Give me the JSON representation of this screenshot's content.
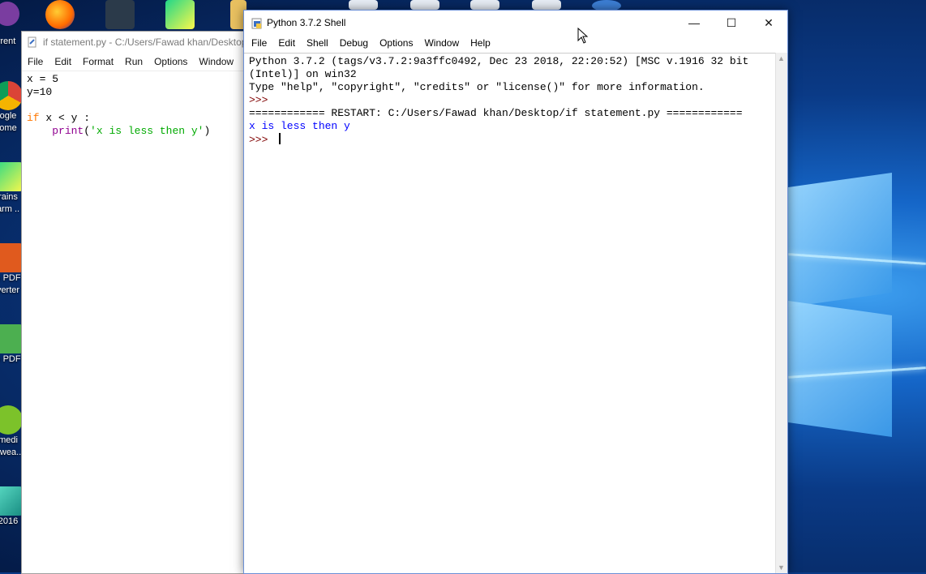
{
  "desktop": {
    "icons": [
      {
        "label": "rrent",
        "icon": "torrent-icon",
        "color": "#7b3fa0"
      },
      {
        "label": "ogle ome",
        "icon": "chrome-icon",
        "color": "#dd4b39"
      },
      {
        "label": "rains arm ..",
        "icon": "pycharm-icon",
        "color": "#21d789"
      },
      {
        "label": "o PDF verter",
        "icon": "pdf-converter-icon",
        "color": "#e05a1e"
      },
      {
        "label": "o PDF",
        "icon": "pdf-icon",
        "color": "#4caf50"
      },
      {
        "label": "medi awea..",
        "icon": "media-icon",
        "color": "#7cc22a"
      },
      {
        "label": "2016",
        "icon": "maya-icon",
        "color": "#22a8a0"
      }
    ],
    "top_icons": [
      "eclipse-icon",
      "firefox-icon",
      "filmora-icon",
      "pycharm-edu-icon",
      "folder-icon",
      "doc-icon",
      "doc2-icon",
      "doc3-icon",
      "doc4-icon",
      "globe-icon"
    ]
  },
  "editor": {
    "title": "if statement.py - C:/Users/Fawad khan/Desktop",
    "menu": [
      "File",
      "Edit",
      "Format",
      "Run",
      "Options",
      "Window"
    ],
    "lines": [
      {
        "plain": "x = 5"
      },
      {
        "plain": "y=10"
      },
      {
        "plain": ""
      },
      {
        "kw": "if",
        "rest": " x < y :"
      },
      {
        "indent": "    ",
        "bi": "print",
        "open": "(",
        "str": "'x is less then y'",
        "close": ")"
      }
    ]
  },
  "shell": {
    "title": "Python 3.7.2 Shell",
    "menu": [
      "File",
      "Edit",
      "Shell",
      "Debug",
      "Options",
      "Window",
      "Help"
    ],
    "controls": {
      "minimize": "—",
      "maximize": "☐",
      "close": "✕"
    },
    "banner1": "Python 3.7.2 (tags/v3.7.2:9a3ffc0492, Dec 23 2018, 22:20:52) [MSC v.1916 32 bit",
    "banner2": "(Intel)] on win32",
    "banner3": "Type \"help\", \"copyright\", \"credits\" or \"license()\" for more information.",
    "prompt1": ">>> ",
    "restart": "============ RESTART: C:/Users/Fawad khan/Desktop/if statement.py ============",
    "output": "x is less then y",
    "prompt2": ">>> "
  }
}
